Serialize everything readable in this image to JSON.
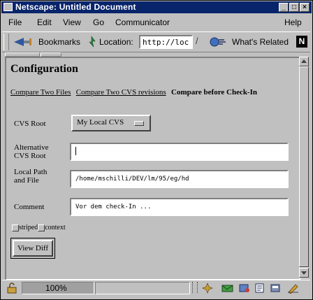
{
  "window": {
    "title": "Netscape: Untitled Document"
  },
  "menubar": {
    "items": [
      "File",
      "Edit",
      "View",
      "Go",
      "Communicator",
      "Help"
    ]
  },
  "toolbar": {
    "bookmarks_label": "Bookmarks",
    "location_label": "Location:",
    "location_value": "http://loc",
    "whats_related_label": "What's Related"
  },
  "page": {
    "heading": "Configuration",
    "nav": {
      "link1": "Compare Two Files",
      "link2": "Compare Two CVS revisions",
      "current": "Compare before Check-In"
    },
    "form": {
      "cvs_root_label": "CVS Root",
      "cvs_root_value": "My Local CVS",
      "alt_root_label_1": "Alternative",
      "alt_root_label_2": "CVS Root",
      "alt_root_value": "",
      "local_path_label_1": "Local Path",
      "local_path_label_2": "and File",
      "local_path_value": "/home/mschilli/DEV/lm/95/eg/hd",
      "comment_label": "Comment",
      "comment_value": "Vor dem check-In ...",
      "striped_label": "striped",
      "context_label": "context",
      "view_diff_label": "View Diff"
    }
  },
  "statusbar": {
    "zoom": "100%"
  }
}
